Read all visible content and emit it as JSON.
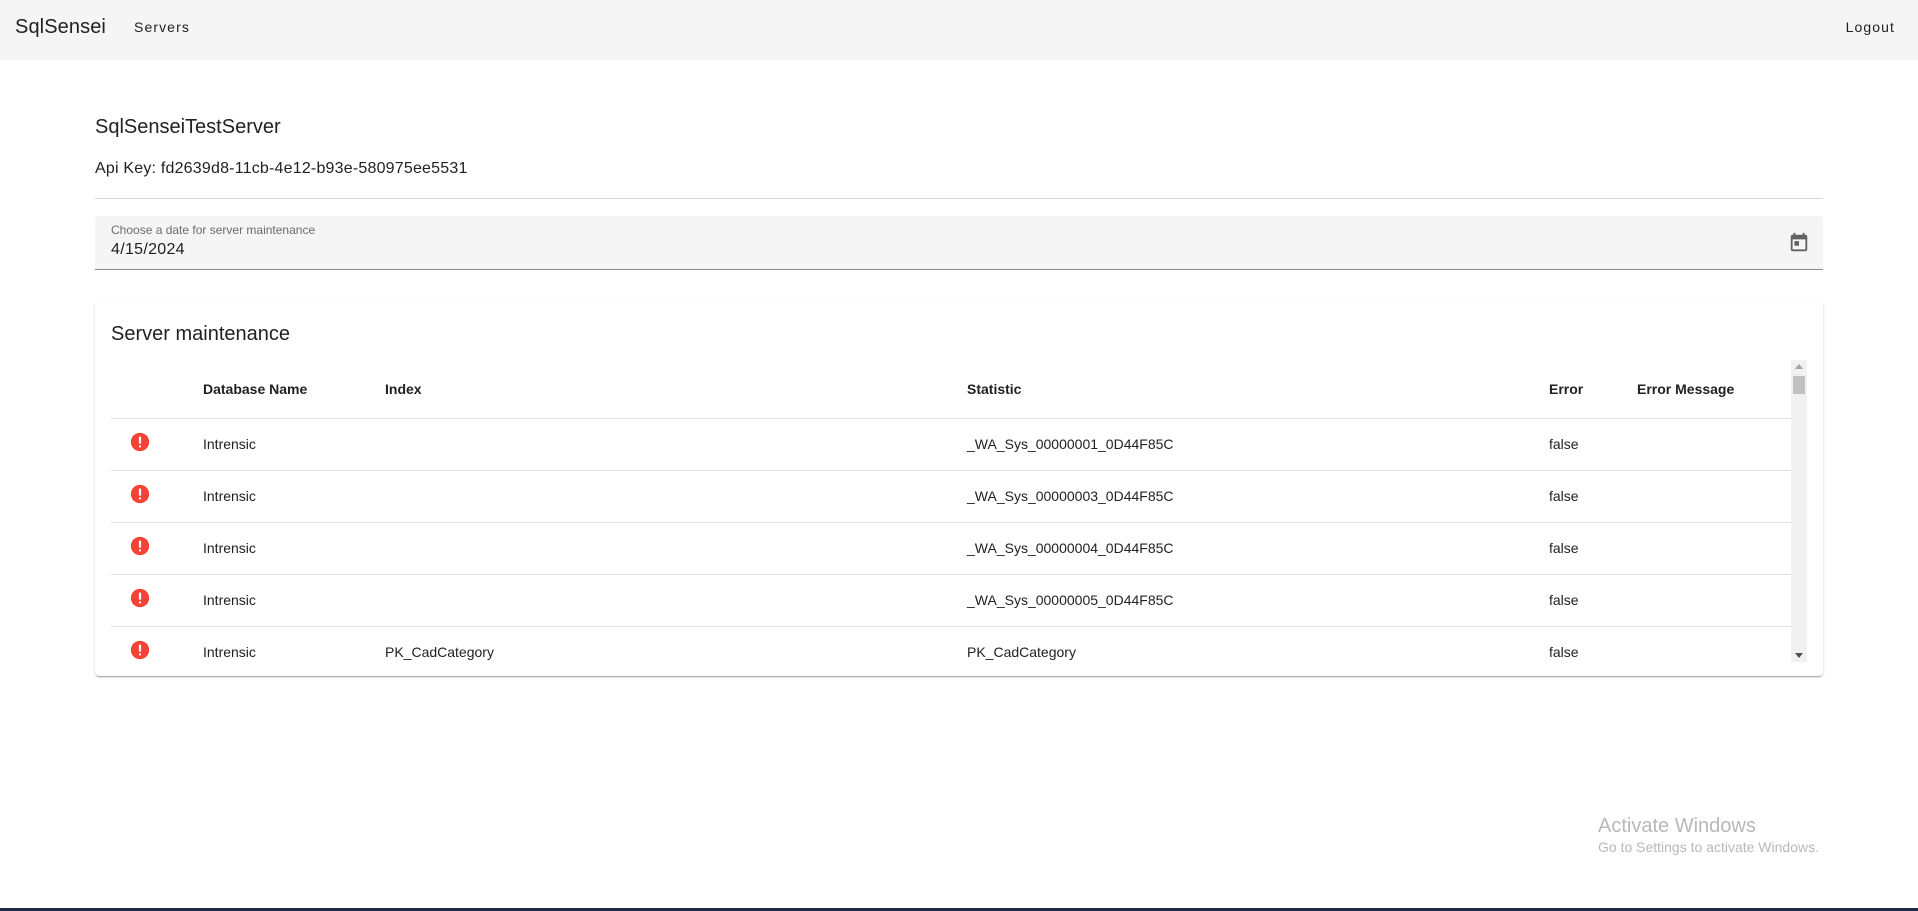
{
  "app": {
    "brand": "SqlSensei",
    "nav_servers": "Servers",
    "nav_logout": "Logout"
  },
  "server": {
    "name": "SqlSenseiTestServer",
    "api_key": "Api Key: fd2639d8-11cb-4e12-b93e-580975ee5531"
  },
  "date_picker": {
    "label": "Choose a date for server maintenance",
    "value": "4/15/2024",
    "icon": "calendar-icon"
  },
  "maintenance": {
    "title": "Server maintenance",
    "columns": [
      "Database Name",
      "Index",
      "Statistic",
      "Error",
      "Error Message"
    ],
    "rows": [
      {
        "icon": "error-icon",
        "database": "Intrensic",
        "index": "",
        "statistic": "_WA_Sys_00000001_0D44F85C",
        "error": "false",
        "error_message": ""
      },
      {
        "icon": "error-icon",
        "database": "Intrensic",
        "index": "",
        "statistic": "_WA_Sys_00000003_0D44F85C",
        "error": "false",
        "error_message": ""
      },
      {
        "icon": "error-icon",
        "database": "Intrensic",
        "index": "",
        "statistic": "_WA_Sys_00000004_0D44F85C",
        "error": "false",
        "error_message": ""
      },
      {
        "icon": "error-icon",
        "database": "Intrensic",
        "index": "",
        "statistic": "_WA_Sys_00000005_0D44F85C",
        "error": "false",
        "error_message": ""
      },
      {
        "icon": "error-icon",
        "database": "Intrensic",
        "index": "PK_CadCategory",
        "statistic": "PK_CadCategory",
        "error": "false",
        "error_message": ""
      }
    ]
  },
  "colors": {
    "error_icon": "#f44336",
    "topbar_bg": "#f5f5f5",
    "field_bg": "#f5f5f5"
  },
  "watermark": {
    "title": "Activate Windows",
    "subtitle": "Go to Settings to activate Windows."
  }
}
